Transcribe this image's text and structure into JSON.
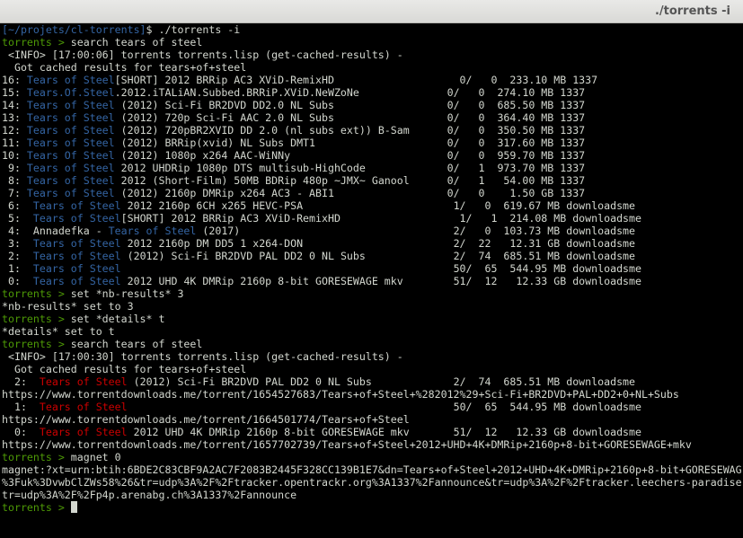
{
  "window": {
    "title": "./torrents -i"
  },
  "colors": {
    "default": "#d3d7cf",
    "green": "#4e9a06",
    "cyan": "#3465a4",
    "red": "#cc0000"
  },
  "terminal": {
    "lines": [
      {
        "seg": [
          {
            "t": "[~/projets/cl-torrents]",
            "c": "cyan"
          },
          {
            "t": "$ ./torrents -i"
          }
        ]
      },
      {
        "seg": [
          {
            "t": "torrents > ",
            "c": "green"
          },
          {
            "t": "search tears of steel"
          }
        ]
      },
      {
        "seg": [
          {
            "t": " <INFO> [17:00:06] torrents torrents.lisp (get-cached-results) -"
          }
        ]
      },
      {
        "seg": [
          {
            "t": "  Got cached results for tears+of+steel"
          }
        ]
      },
      {
        "seg": [
          {
            "t": "16: "
          },
          {
            "t": "Tears of Steel",
            "c": "cyan"
          },
          {
            "t": "[SHORT] 2012 BRRip AC3 XViD-RemixHD                    0/   0  233.10 MB 1337"
          }
        ]
      },
      {
        "seg": [
          {
            "t": "15: "
          },
          {
            "t": "Tears.Of.Steel",
            "c": "cyan"
          },
          {
            "t": ".2012.iTALiAN.Subbed.BRRiP.XViD.NeWZoNe              0/   0  274.10 MB 1337"
          }
        ]
      },
      {
        "seg": [
          {
            "t": "14: "
          },
          {
            "t": "Tears of Steel",
            "c": "cyan"
          },
          {
            "t": " (2012) Sci-Fi BR2DVD DD2.0 NL Subs                  0/   0  685.50 MB 1337"
          }
        ]
      },
      {
        "seg": [
          {
            "t": "13: "
          },
          {
            "t": "Tears of Steel",
            "c": "cyan"
          },
          {
            "t": " (2012) 720p Sci-Fi AAC 2.0 NL Subs                  0/   0  364.40 MB 1337"
          }
        ]
      },
      {
        "seg": [
          {
            "t": "12: "
          },
          {
            "t": "Tears of Steel",
            "c": "cyan"
          },
          {
            "t": " (2012) 720pBR2XVID DD 2.0 (nl subs ext)) B-Sam      0/   0  350.50 MB 1337"
          }
        ]
      },
      {
        "seg": [
          {
            "t": "11: "
          },
          {
            "t": "Tears of Steel",
            "c": "cyan"
          },
          {
            "t": " (2012) BRRip(xvid) NL Subs DMT1                     0/   0  317.60 MB 1337"
          }
        ]
      },
      {
        "seg": [
          {
            "t": "10: "
          },
          {
            "t": "Tears Of Steel",
            "c": "cyan"
          },
          {
            "t": " (2012) 1080p x264 AAC-WiNNy                         0/   0  959.70 MB 1337"
          }
        ]
      },
      {
        "seg": [
          {
            "t": " 9: "
          },
          {
            "t": "Tears of Steel",
            "c": "cyan"
          },
          {
            "t": " 2012 UHDRip 1080p DTS multisub-HighCode             0/   1  973.70 MB 1337"
          }
        ]
      },
      {
        "seg": [
          {
            "t": " 8: "
          },
          {
            "t": "Tears of Steel",
            "c": "cyan"
          },
          {
            "t": " 2012 (Short-Film) 50MB BDRip 480p ~JMX~ Ganool      0/   1   54.00 MB 1337"
          }
        ]
      },
      {
        "seg": [
          {
            "t": " 7: "
          },
          {
            "t": "Tears of Steel",
            "c": "cyan"
          },
          {
            "t": " (2012) 2160p DMRip x264 AC3 - ABI1                  0/   0    1.50 GB 1337"
          }
        ]
      },
      {
        "seg": [
          {
            "t": " 6:  "
          },
          {
            "t": "Tears of Steel",
            "c": "cyan"
          },
          {
            "t": " 2012 2160p 6CH x265 HEVC-PSA                        1/   0  619.67 MB downloadsme"
          }
        ]
      },
      {
        "seg": [
          {
            "t": " 5:  "
          },
          {
            "t": "Tears of Steel",
            "c": "cyan"
          },
          {
            "t": "[SHORT] 2012 BRRip AC3 XViD-RemixHD                   1/   1  214.08 MB downloadsme"
          }
        ]
      },
      {
        "seg": [
          {
            "t": " 4:  Annadefka - "
          },
          {
            "t": "Tears of Steel",
            "c": "cyan"
          },
          {
            "t": " (2017)                                  2/   0  103.73 MB downloadsme"
          }
        ]
      },
      {
        "seg": [
          {
            "t": " 3:  "
          },
          {
            "t": "Tears of Steel",
            "c": "cyan"
          },
          {
            "t": " 2012 2160p DM DD5 1 x264-DON                        2/  22   12.31 GB downloadsme"
          }
        ]
      },
      {
        "seg": [
          {
            "t": " 2:  "
          },
          {
            "t": "Tears of Steel",
            "c": "cyan"
          },
          {
            "t": " (2012) Sci-Fi BR2DVD PAL DD2 0 NL Subs              2/  74  685.51 MB downloadsme"
          }
        ]
      },
      {
        "seg": [
          {
            "t": " 1:  "
          },
          {
            "t": "Tears of Steel",
            "c": "cyan"
          },
          {
            "t": "                                                     50/  65  544.95 MB downloadsme"
          }
        ]
      },
      {
        "seg": [
          {
            "t": " 0:  "
          },
          {
            "t": "Tears of Steel",
            "c": "cyan"
          },
          {
            "t": " 2012 UHD 4K DMRip 2160p 8-bit GORESEWAGE mkv        51/  12   12.33 GB downloadsme"
          }
        ]
      },
      {
        "seg": [
          {
            "t": "torrents > ",
            "c": "green"
          },
          {
            "t": "set *nb-results* 3"
          }
        ]
      },
      {
        "seg": [
          {
            "t": "*nb-results* set to 3"
          }
        ]
      },
      {
        "seg": [
          {
            "t": "torrents > ",
            "c": "green"
          },
          {
            "t": "set *details* t"
          }
        ]
      },
      {
        "seg": [
          {
            "t": "*details* set to t"
          }
        ]
      },
      {
        "seg": [
          {
            "t": "torrents > ",
            "c": "green"
          },
          {
            "t": "search tears of steel"
          }
        ]
      },
      {
        "seg": [
          {
            "t": " <INFO> [17:00:30] torrents torrents.lisp (get-cached-results) -"
          }
        ]
      },
      {
        "seg": [
          {
            "t": "  Got cached results for tears+of+steel"
          }
        ]
      },
      {
        "seg": [
          {
            "t": "  2:  "
          },
          {
            "t": "Tears of Steel",
            "c": "red"
          },
          {
            "t": " (2012) Sci-Fi BR2DVD PAL DD2 0 NL Subs             2/  74  685.51 MB downloadsme"
          }
        ]
      },
      {
        "seg": [
          {
            "t": "https://www.torrentdownloads.me/torrent/1654527683/Tears+of+Steel+%282012%29+Sci-Fi+BR2DVD+PAL+DD2+0+NL+Subs"
          }
        ]
      },
      {
        "seg": [
          {
            "t": "  1:  "
          },
          {
            "t": "Tears of Steel",
            "c": "red"
          },
          {
            "t": "                                                    50/  65  544.95 MB downloadsme"
          }
        ]
      },
      {
        "seg": [
          {
            "t": "https://www.torrentdownloads.me/torrent/1664501774/Tears+of+Steel"
          }
        ]
      },
      {
        "seg": [
          {
            "t": "  0:  "
          },
          {
            "t": "Tears of Steel",
            "c": "red"
          },
          {
            "t": " 2012 UHD 4K DMRip 2160p 8-bit GORESEWAGE mkv       51/  12   12.33 GB downloadsme"
          }
        ]
      },
      {
        "seg": [
          {
            "t": "https://www.torrentdownloads.me/torrent/1657702739/Tears+of+Steel+2012+UHD+4K+DMRip+2160p+8-bit+GORESEWAGE+mkv"
          }
        ]
      },
      {
        "seg": [
          {
            "t": "torrents > ",
            "c": "green"
          },
          {
            "t": "magnet 0"
          }
        ]
      },
      {
        "seg": [
          {
            "t": "magnet:?xt=urn:btih:6BDE2C83CBF9A2AC7F2083B2445F328CC139B1E7&dn=Tears+of+Steel+2012+UHD+4K+DMRip+2160p+8-bit+GORESEWAG"
          }
        ]
      },
      {
        "seg": [
          {
            "t": "%3Fuk%3DvwbClZWs58%26&tr=udp%3A%2F%2Ftracker.opentrackr.org%3A1337%2Fannounce&tr=udp%3A%2F%2Ftracker.leechers-paradise"
          }
        ]
      },
      {
        "seg": [
          {
            "t": "tr=udp%3A%2F%2Fp4p.arenabg.ch%3A1337%2Fannounce"
          }
        ]
      },
      {
        "seg": [
          {
            "t": "torrents > ",
            "c": "green"
          }
        ],
        "cursor": true
      }
    ]
  }
}
